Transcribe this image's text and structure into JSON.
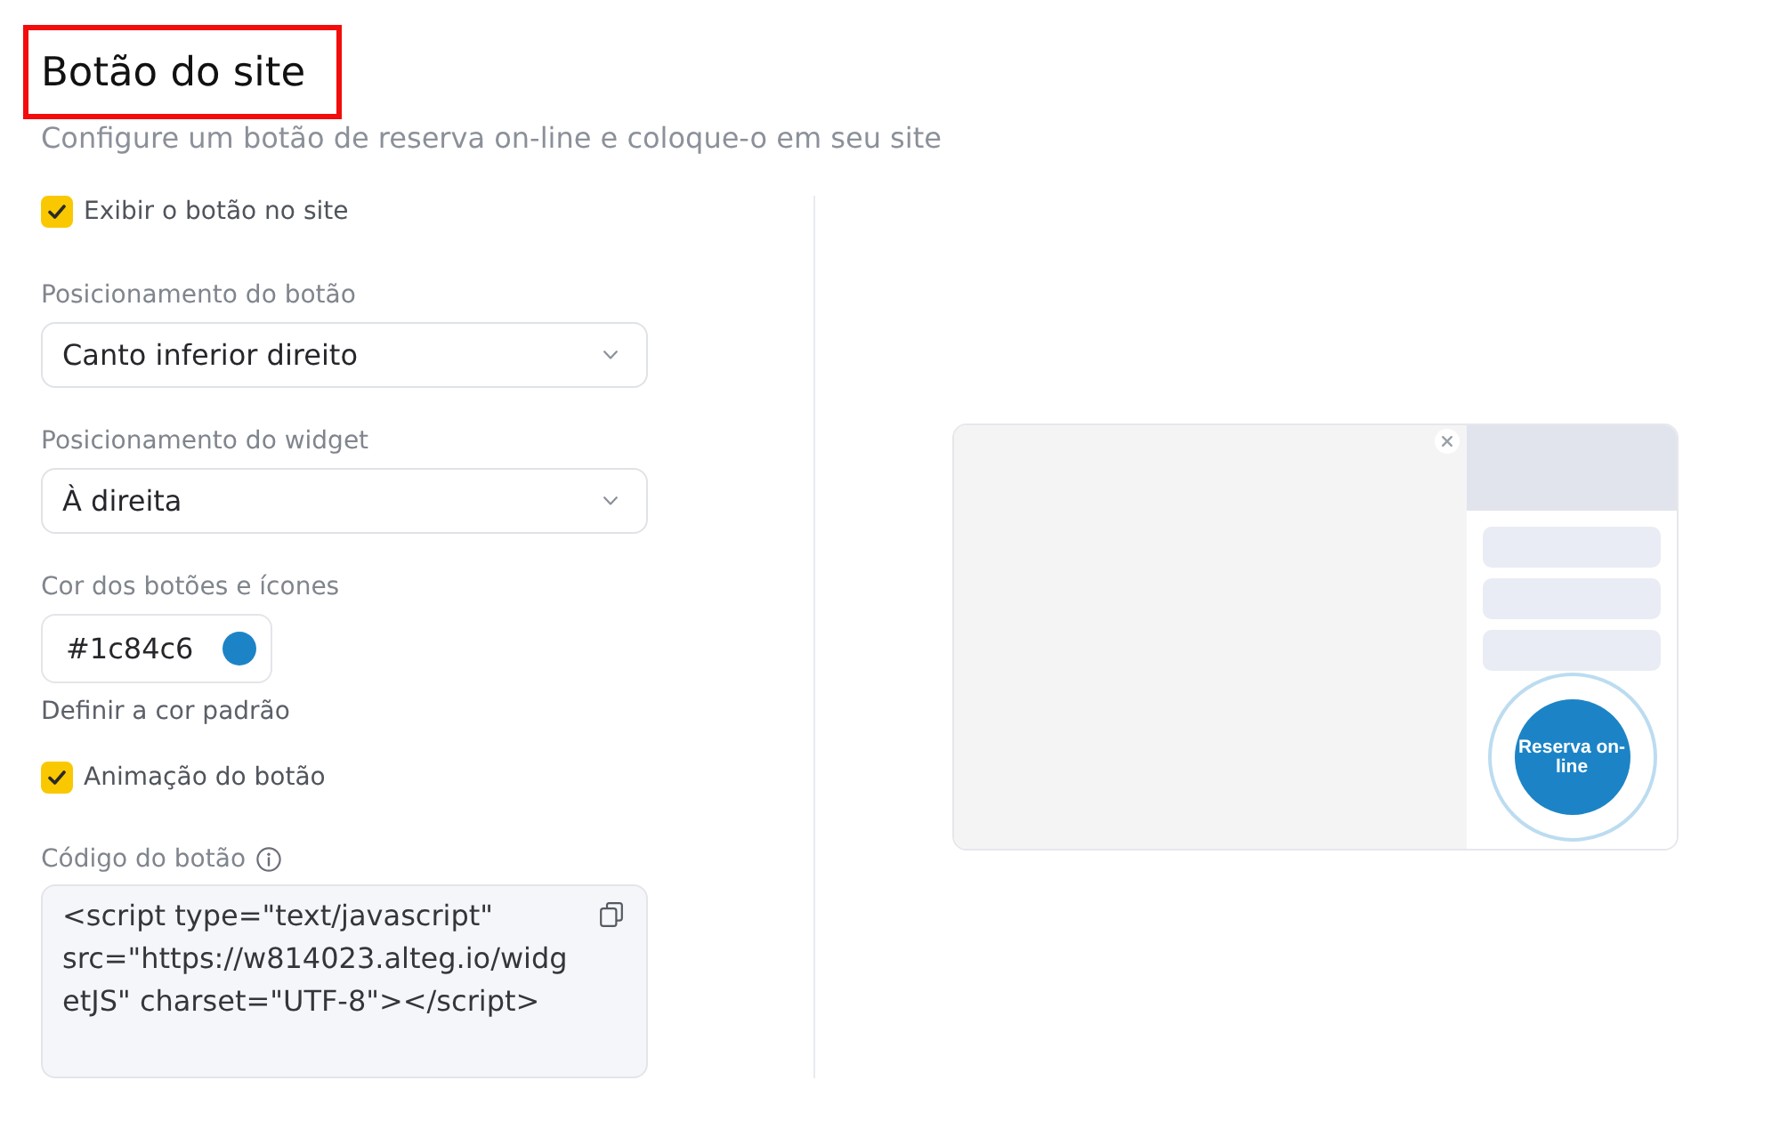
{
  "header": {
    "title": "Botão do site",
    "highlighted": true,
    "subtitle": "Configure um botão de reserva on-line e coloque-o em seu site"
  },
  "settings": [
    {
      "kind": "checkbox",
      "label": "Exibir o botão no site",
      "checked": true
    },
    {
      "kind": "select",
      "label": "Posicionamento do botão",
      "value": "Canto inferior direito"
    },
    {
      "kind": "select",
      "label": "Posicionamento do widget",
      "value": "À direita"
    },
    {
      "kind": "color",
      "label": "Cor dos botões e ícones",
      "value": "#1c84c6",
      "color": "#1c84c6",
      "link": "Definir a cor padrão"
    },
    {
      "kind": "checkbox",
      "label": "Animação do botão",
      "checked": true
    },
    {
      "kind": "code",
      "label": "Código do botão",
      "value": "<script type=\"text/javascript\" src=\"https://w814023.alteg.io/widgetJS\" charset=\"UTF-8\"></script>"
    }
  ],
  "preview": {
    "button_label": "Reserva on-line"
  }
}
